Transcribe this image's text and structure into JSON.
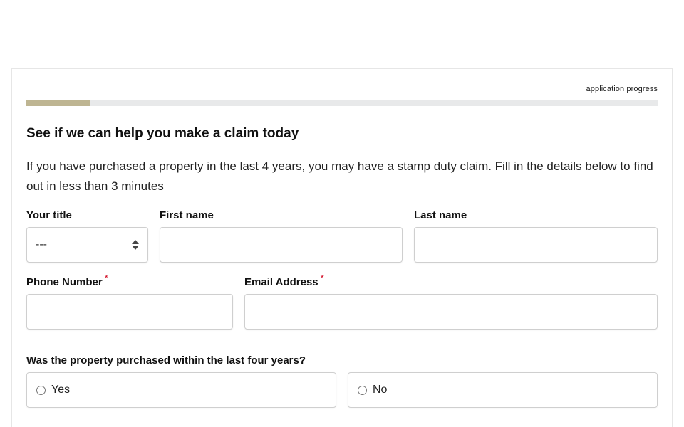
{
  "progress": {
    "label": "application progress",
    "fraction": 0.1
  },
  "form": {
    "heading": "See if we can help you make a claim today",
    "intro": "If you have purchased a property in the last 4 years, you may have a stamp duty claim. Fill in the details below to find out in less than 3 minutes",
    "title_field": {
      "label": "Your title",
      "value": "---"
    },
    "first_name": {
      "label": "First name",
      "value": ""
    },
    "last_name": {
      "label": "Last name",
      "value": ""
    },
    "phone": {
      "label": "Phone Number",
      "required_mark": "*",
      "value": ""
    },
    "email": {
      "label": "Email Address",
      "required_mark": "*",
      "value": ""
    },
    "question": {
      "label": "Was the property purchased within the last four years?",
      "options": [
        "Yes",
        "No"
      ]
    }
  },
  "colors": {
    "progress_fill": "#beb592",
    "progress_track": "#e8e9ea",
    "required": "#d0021b"
  }
}
